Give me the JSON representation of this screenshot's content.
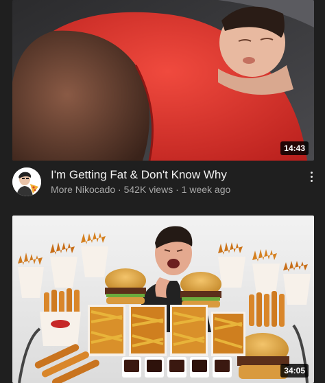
{
  "videos": [
    {
      "duration": "14:43",
      "title": "I'm Getting Fat & Don't Know Why",
      "channel": "More Nikocado",
      "views": "542K views",
      "age": "1 week ago",
      "separator": " · "
    },
    {
      "duration": "34:05"
    }
  ],
  "icons": {
    "more": "kebab-menu-icon",
    "avatar": "channel-avatar"
  },
  "colors": {
    "background": "#1f1f1f",
    "title": "#f1f1f1",
    "subtext": "#a8a8a8",
    "shirt": "#e5332e"
  }
}
